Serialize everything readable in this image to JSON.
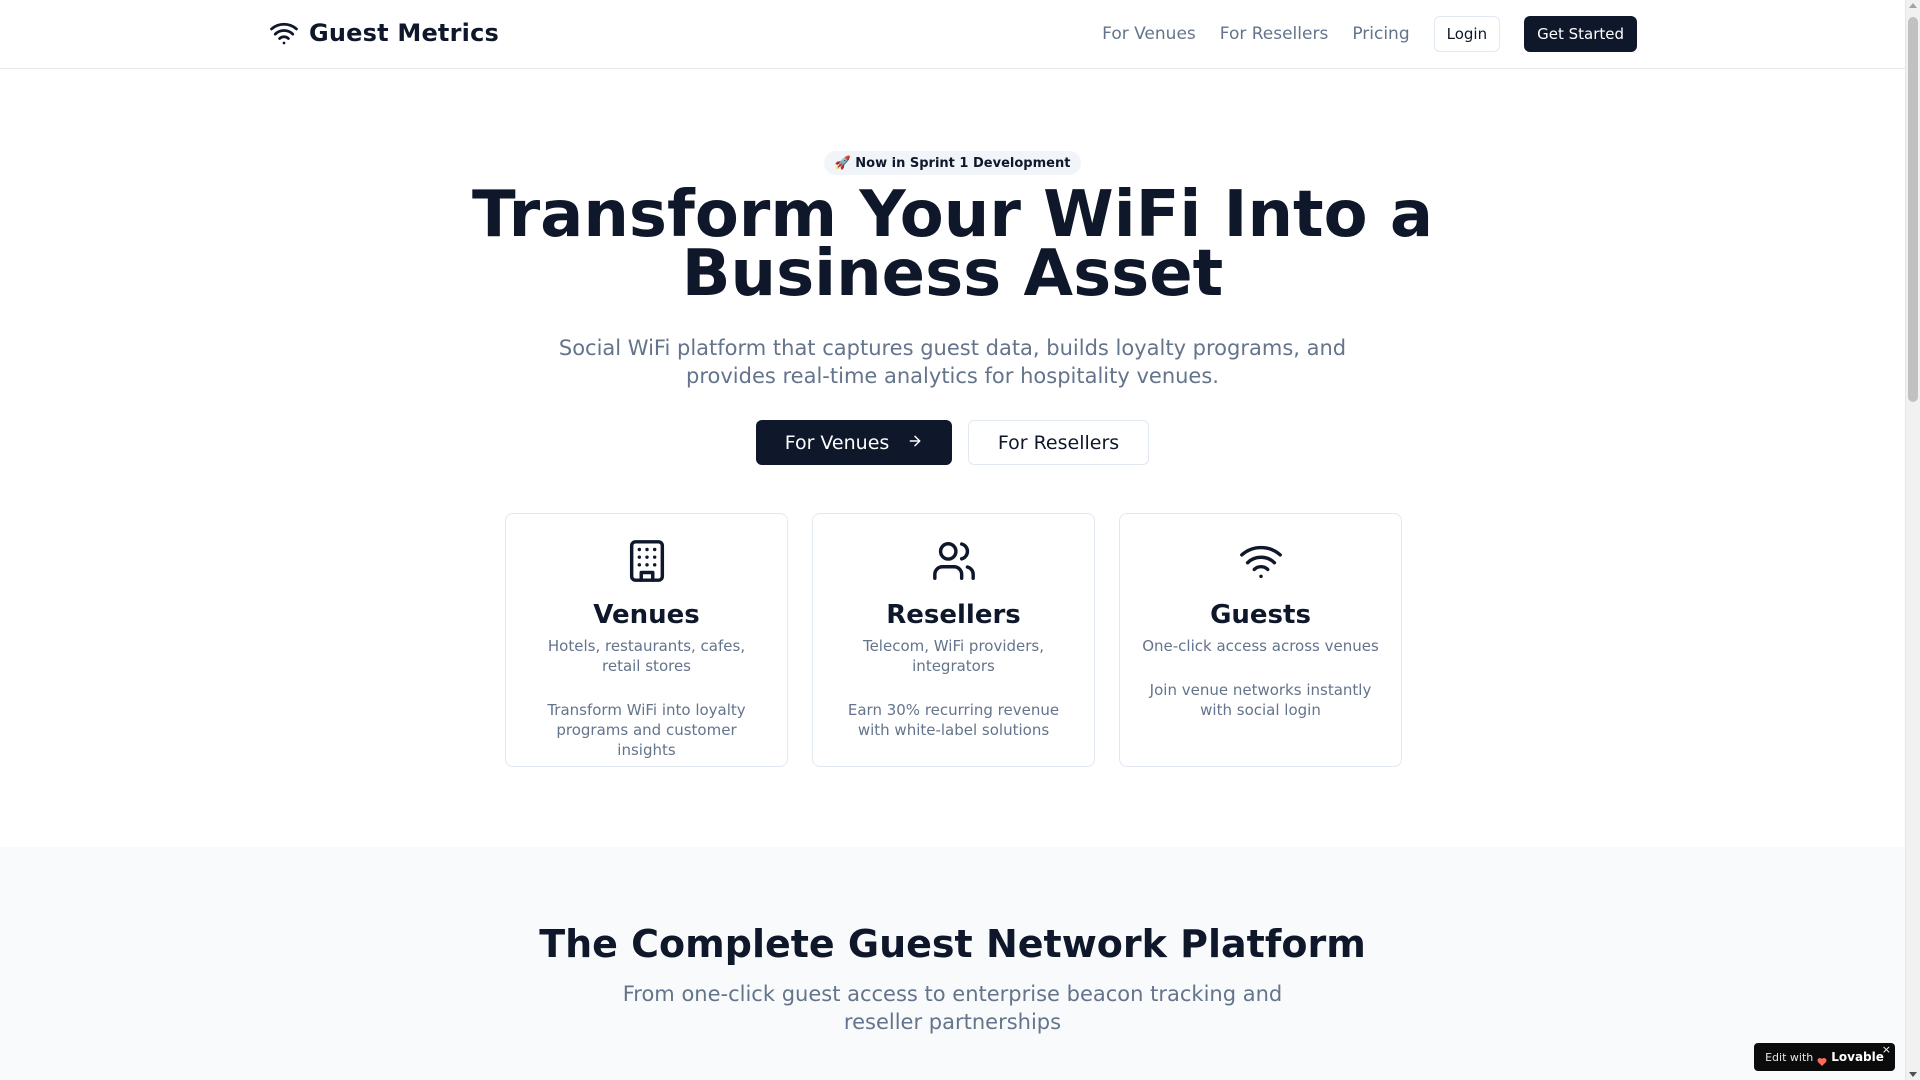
{
  "header": {
    "brand": "Guest Metrics",
    "nav": [
      "For Venues",
      "For Resellers",
      "Pricing"
    ],
    "login_label": "Login",
    "get_started_label": "Get Started"
  },
  "hero": {
    "badge": "🚀 Now in Sprint 1 Development",
    "title_line1": "Transform Your WiFi Into a",
    "title_line2": "Business Asset",
    "subtitle": "Social WiFi platform that captures guest data, builds loyalty programs, and provides real-time analytics for hospitality venues.",
    "cta_primary": "For Venues",
    "cta_secondary": "For Resellers"
  },
  "cards": [
    {
      "icon": "building-icon",
      "title": "Venues",
      "desc": "Hotels, restaurants, cafes, retail stores",
      "note": "Transform WiFi into loyalty programs and customer insights"
    },
    {
      "icon": "users-icon",
      "title": "Resellers",
      "desc": "Telecom, WiFi providers, integrators",
      "note": "Earn 30% recurring revenue with white-label solutions"
    },
    {
      "icon": "wifi-icon",
      "title": "Guests",
      "desc": "One-click access across venues",
      "note": "Join venue networks instantly with social login"
    }
  ],
  "platform": {
    "title": "The Complete Guest Network Platform",
    "subtitle": "From one-click guest access to enterprise beacon tracking and reseller partnerships"
  },
  "lovable": {
    "prefix": "Edit with",
    "brand": "Lovable",
    "close": "×"
  },
  "colors": {
    "primary": "#0f172a",
    "muted_text": "#64748b",
    "border": "#e2e8f0",
    "section_bg": "#f8fafc"
  }
}
